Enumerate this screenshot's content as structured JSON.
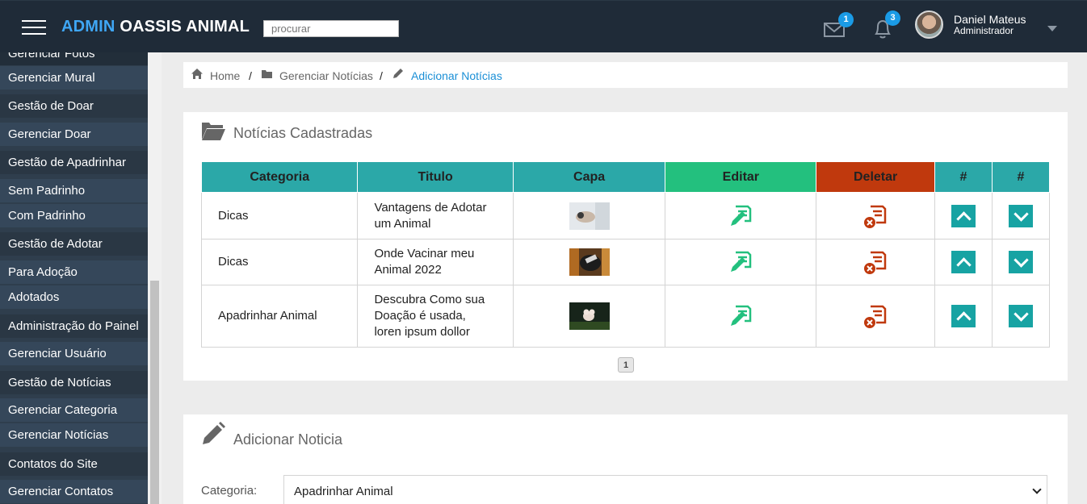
{
  "header": {
    "brand_accent": "ADMIN",
    "brand_name": "OASSIS ANIMAL",
    "search_placeholder": "procurar",
    "messages_count": "1",
    "notifications_count": "3",
    "user_name": "Daniel Mateus",
    "user_role": "Administrador"
  },
  "sidebar": {
    "items": [
      {
        "label": "Gerenciar Fotos"
      },
      {
        "label": "Gerenciar Mural"
      },
      {
        "label": "Gestão de Doar"
      },
      {
        "label": "Gerenciar Doar"
      },
      {
        "label": "Gestão de Apadrinhar"
      },
      {
        "label": "Sem Padrinho"
      },
      {
        "label": "Com Padrinho"
      },
      {
        "label": "Gestão de Adotar"
      },
      {
        "label": "Para Adoção"
      },
      {
        "label": "Adotados"
      },
      {
        "label": "Administração do Painel"
      },
      {
        "label": "Gerenciar Usuário"
      },
      {
        "label": "Gestão de Notícias"
      },
      {
        "label": "Gerenciar Categoria"
      },
      {
        "label": "Gerenciar Notícias"
      },
      {
        "label": "Contatos do Site"
      },
      {
        "label": "Gerenciar Contatos"
      }
    ]
  },
  "breadcrumb": {
    "home": "Home",
    "sep1": "/",
    "manage": "Gerenciar Notícias",
    "sep2": "/",
    "current": "Adicionar Notícias"
  },
  "news_panel": {
    "title": "Notícias Cadastradas",
    "columns": [
      "Categoria",
      "Titulo",
      "Capa",
      "Editar",
      "Deletar",
      "#",
      "#"
    ],
    "rows": [
      {
        "category": "Dicas",
        "title_lines": [
          "Vantagens de Adotar",
          "um Animal"
        ]
      },
      {
        "category": "Dicas",
        "title_lines": [
          "Onde Vacinar meu",
          "Animal 2022"
        ]
      },
      {
        "category": "Apadrinhar Animal",
        "title_lines": [
          "Descubra Como sua",
          "Doação é usada,",
          "loren ipsum dollor"
        ]
      }
    ],
    "page": "1"
  },
  "add_panel": {
    "title": "Adicionar Noticia",
    "category_label": "Categoria:",
    "category_value": "Apadrinhar Animal"
  },
  "colors": {
    "topbar": "#1f2b38",
    "brand_accent": "#3fa7f5",
    "table_header": "#2ba8a8",
    "edit": "#23c07e",
    "delete": "#c0390d",
    "arrow_button": "#17a3a3",
    "badge": "#1a9be6"
  },
  "icons": {
    "menu": "hamburger-icon",
    "mail": "envelope-icon",
    "bell": "bell-icon",
    "home": "home-icon",
    "folder": "folder-icon",
    "pencil": "pencil-icon",
    "edit": "edit-document-icon",
    "delete": "delete-document-icon"
  }
}
